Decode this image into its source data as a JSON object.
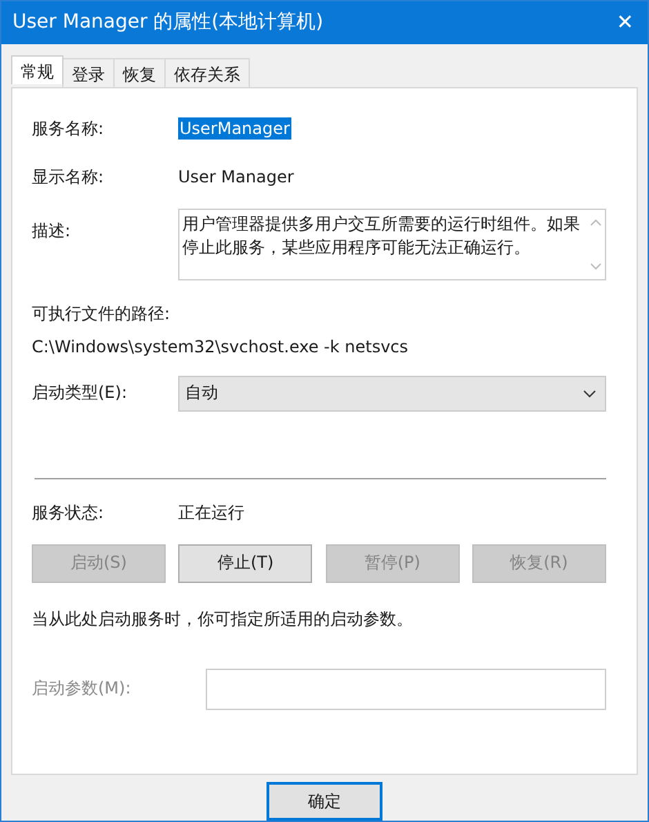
{
  "window": {
    "title": "User Manager 的属性(本地计算机)",
    "close": "✕"
  },
  "tabs": [
    {
      "label": "常规",
      "selected": true
    },
    {
      "label": "登录",
      "selected": false
    },
    {
      "label": "恢复",
      "selected": false
    },
    {
      "label": "依存关系",
      "selected": false
    }
  ],
  "service_name": {
    "label": "服务名称:",
    "value": "UserManager",
    "selected": true
  },
  "display_name": {
    "label": "显示名称:",
    "value": "User Manager"
  },
  "description": {
    "label": "描述:",
    "value": "用户管理器提供多用户交互所需要的运行时组件。如果停止此服务，某些应用程序可能无法正确运行。"
  },
  "executable_path": {
    "label": "可执行文件的路径:",
    "value": "C:\\Windows\\system32\\svchost.exe -k netsvcs"
  },
  "startup_type": {
    "label": "启动类型(E):",
    "value": "自动"
  },
  "service_status": {
    "label": "服务状态:",
    "value": "正在运行"
  },
  "control_buttons": [
    {
      "label": "启动(S)",
      "disabled": true
    },
    {
      "label": "停止(T)",
      "disabled": false
    },
    {
      "label": "暂停(P)",
      "disabled": true
    },
    {
      "label": "恢复(R)",
      "disabled": true
    }
  ],
  "note": "当从此处启动服务时，你可指定所适用的启动参数。",
  "start_parameters": {
    "label": "启动参数(M):",
    "disabled": true
  },
  "buttons": [
    {
      "label": "确定",
      "default": true
    }
  ]
}
